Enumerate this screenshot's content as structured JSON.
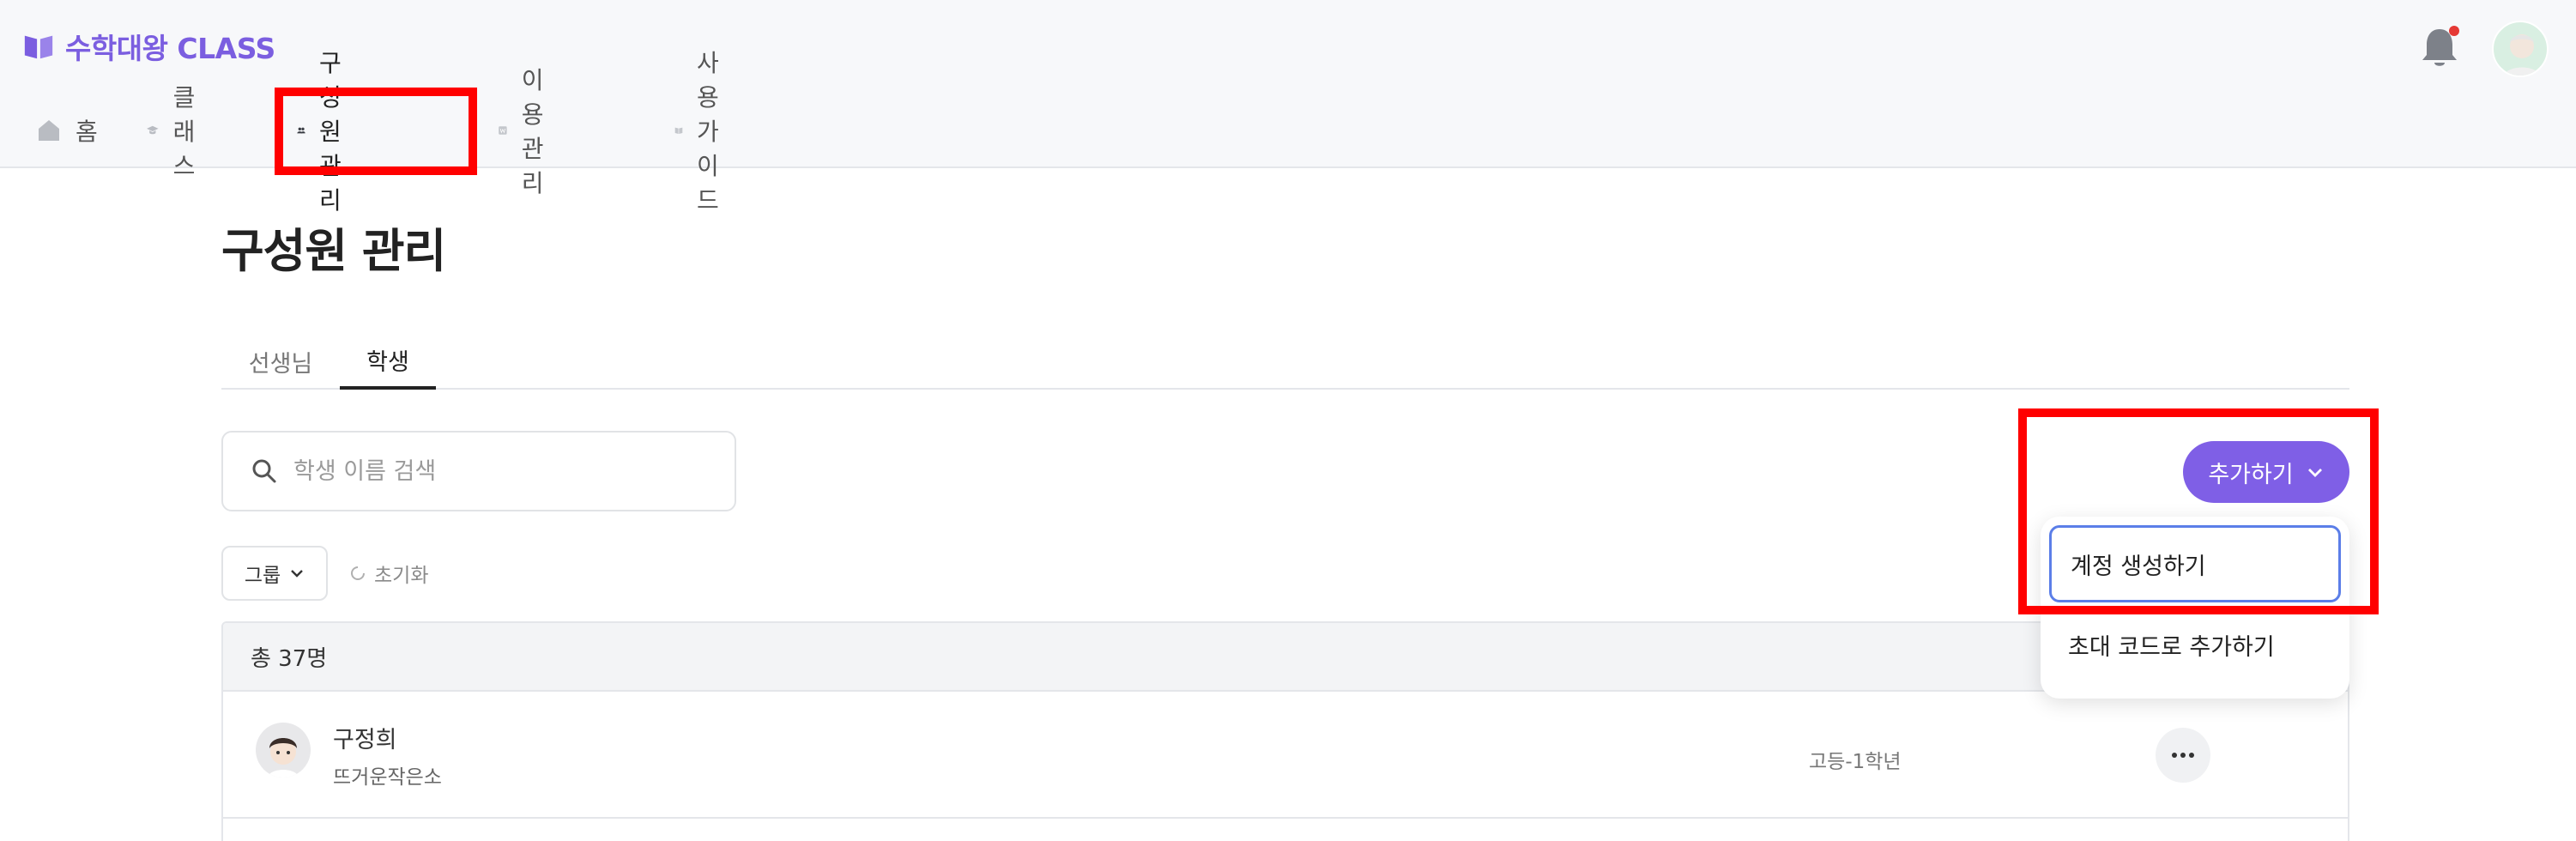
{
  "app": {
    "brand": "수학대왕 CLASS",
    "brand_color": "#7b5ee0"
  },
  "header": {
    "icons": [
      "bell-icon",
      "avatar"
    ],
    "notification_dot_color": "#e53935"
  },
  "nav": [
    {
      "label": "홈",
      "icon": "home-icon"
    },
    {
      "label": "클래스",
      "icon": "graduation-cap-icon"
    },
    {
      "label": "구성원 관리",
      "icon": "users-icon",
      "active": true
    },
    {
      "label": "이용 관리",
      "icon": "won-card-icon"
    },
    {
      "label": "사용 가이드",
      "icon": "book-icon"
    }
  ],
  "main": {
    "title": "구성원 관리",
    "tabs": [
      {
        "label": "선생님",
        "active": false
      },
      {
        "label": "학생",
        "active": true
      }
    ],
    "search": {
      "placeholder": "학생 이름 검색",
      "value": ""
    },
    "filters": {
      "group_label": "그룹",
      "reset_label": "초기화"
    },
    "add_button": {
      "label": "추가하기",
      "color": "#7f5fe6"
    },
    "dropdown": {
      "items": [
        {
          "label": "계정 생성하기",
          "focused": true
        },
        {
          "label": "초대 코드로 추가하기",
          "focused": false
        }
      ]
    },
    "table": {
      "total": "총 37명",
      "rows": [
        {
          "name": "구정희",
          "nickname": "뜨거운작은소",
          "grade": "고등-1학년"
        }
      ]
    }
  },
  "highlight_color": "#ff0000"
}
